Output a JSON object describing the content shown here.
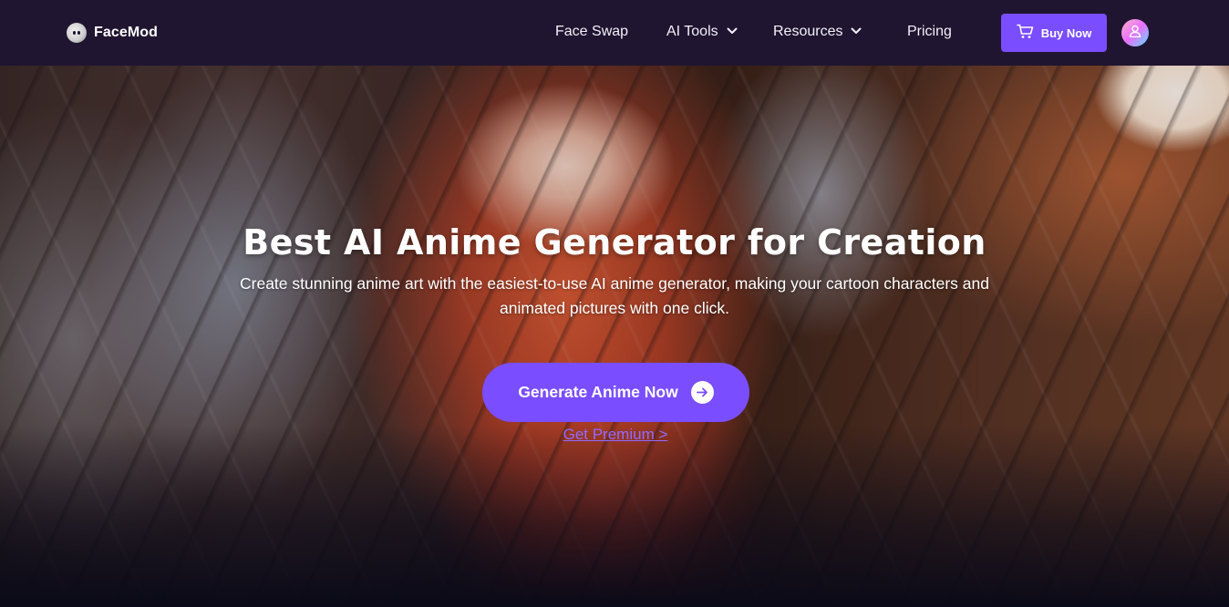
{
  "header": {
    "brand": "FaceMod",
    "nav": [
      {
        "label": "Face Swap",
        "has_dropdown": false
      },
      {
        "label": "AI Tools",
        "has_dropdown": true
      },
      {
        "label": "Resources",
        "has_dropdown": true
      },
      {
        "label": "Pricing",
        "has_dropdown": false
      }
    ],
    "buy_button": {
      "label": "Buy Now",
      "icon": "cart-icon"
    },
    "avatar_icon": "user-icon"
  },
  "hero": {
    "title": "Best AI Anime Generator for Creation",
    "subtitle": "Create stunning anime art with the easiest-to-use AI anime generator, making your cartoon characters and animated pictures with one click.",
    "cta_label": "Generate Anime Now",
    "cta_icon": "arrow-right-icon",
    "premium_link": "Get Premium >"
  },
  "colors": {
    "header_bg": "#1f1530",
    "accent": "#7a4dff",
    "link": "#8f6bff",
    "page_bg": "#0b0a18"
  }
}
